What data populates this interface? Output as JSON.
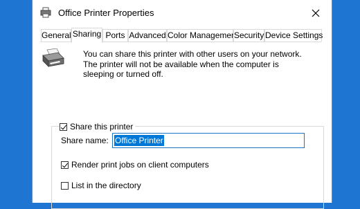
{
  "window": {
    "title": "Office Printer Properties",
    "icon": "printer-icon",
    "close_icon": "close-icon"
  },
  "tabs": [
    {
      "label": "General"
    },
    {
      "label": "Sharing",
      "active": true
    },
    {
      "label": "Ports"
    },
    {
      "label": "Advanced"
    },
    {
      "label": "Color Management"
    },
    {
      "label": "Security"
    },
    {
      "label": "Device Settings"
    }
  ],
  "sharing": {
    "description": "You can share this printer with other users on your network. The printer will not be available when the computer is sleeping or turned off.",
    "share_printer": {
      "label": "Share this printer",
      "checked": true
    },
    "share_name": {
      "label": "Share name:",
      "value": "Office Printer"
    },
    "render_jobs": {
      "label": "Render print jobs on client computers",
      "checked": true
    },
    "list_directory": {
      "label": "List in the directory",
      "checked": false
    }
  },
  "colors": {
    "desktop": "#1f76d2",
    "selection": "#0078d7",
    "input_focus_border": "#1a73c4"
  }
}
